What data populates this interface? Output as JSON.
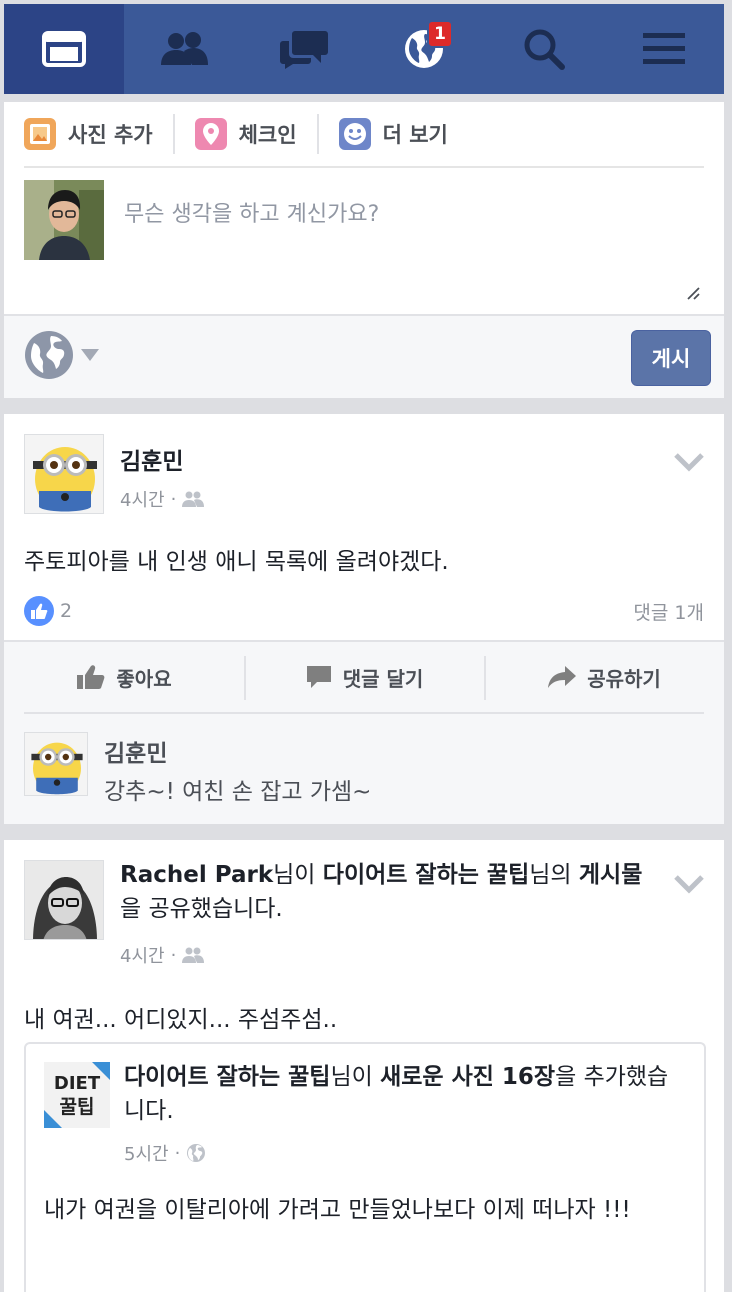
{
  "nav": {
    "items": [
      {
        "name": "news-feed",
        "icon": "news-feed-icon",
        "active": true
      },
      {
        "name": "friend-requests",
        "icon": "friends-icon"
      },
      {
        "name": "messages",
        "icon": "messages-icon"
      },
      {
        "name": "notifications",
        "icon": "globe-icon",
        "badge": "1"
      },
      {
        "name": "search",
        "icon": "search-icon"
      },
      {
        "name": "menu",
        "icon": "hamburger-menu-icon"
      }
    ],
    "notification_badge": "1",
    "colors": {
      "bar": "#3b5998",
      "active": "#2c4486",
      "badge": "#dd2a2a"
    }
  },
  "composer": {
    "add_photo_label": "사진 추가",
    "checkin_label": "체크인",
    "more_label": "더 보기",
    "placeholder": "무슨 생각을 하고 계신가요?",
    "post_label": "게시",
    "audience_icon": "globe-icon"
  },
  "post1": {
    "author": "김훈민",
    "time": "4시간",
    "dot": "·",
    "audience_icon": "friends-icon",
    "text": "주토피아를 내 인생 애니 목록에 올려야겠다.",
    "like_count": "2",
    "comment_count": "댓글 1개",
    "actions": {
      "like": "좋아요",
      "comment": "댓글 달기",
      "share": "공유하기"
    },
    "comment": {
      "author": "김훈민",
      "text": "강추~! 여친 손 잡고 가셈~"
    }
  },
  "post2": {
    "author": "Rachel Park",
    "connector1": "님이 ",
    "page": "다이어트 잘하는 꿀팁",
    "connector2": "님의 ",
    "object": "게시물",
    "suffix": "을 공유했습니다.",
    "time": "4시간",
    "dot": "·",
    "audience_icon": "friends-icon",
    "text": "내 여권... 어디있지... 주섬주섬..",
    "shared": {
      "thumb_line1": "DIET",
      "thumb_line2": "꿀팁",
      "page": "다이어트 잘하는 꿀팁",
      "connector": "님이 ",
      "object": "새로운 사진 16장",
      "suffix": "을 추가했습니다.",
      "time": "5시간",
      "dot": "·",
      "audience_icon": "globe-icon",
      "text": "내가 여권을 이탈리아에 가려고 만들었나보다 이제 떠나자 !!!"
    }
  }
}
